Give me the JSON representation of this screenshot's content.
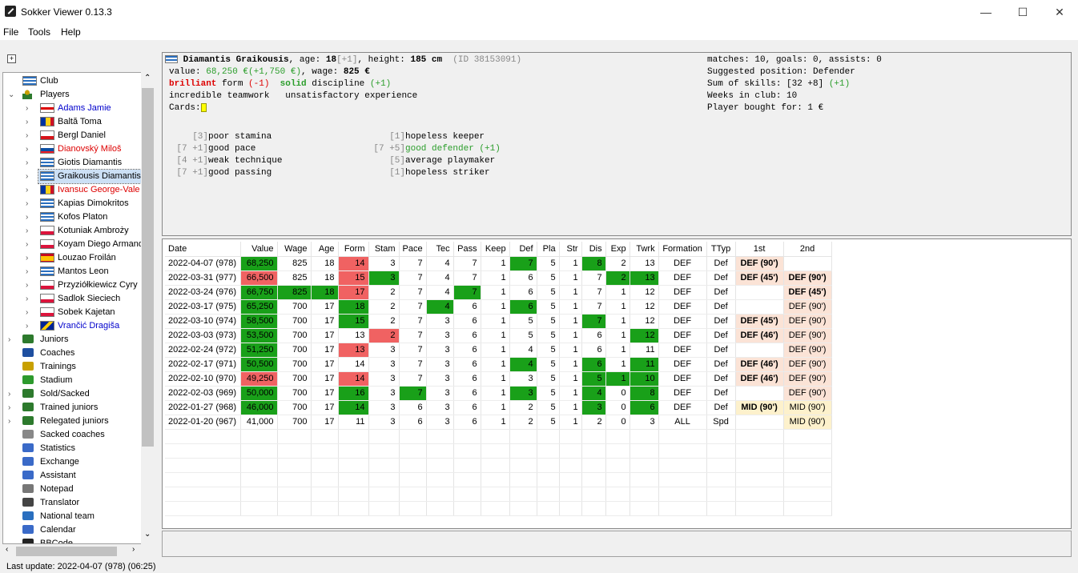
{
  "window": {
    "title": "Sokker Viewer 0.13.3",
    "minimize": "—",
    "maximize": "☐",
    "close": "✕"
  },
  "menu": [
    "File",
    "Tools",
    "Help"
  ],
  "tree": {
    "expand_all": "+",
    "club": "Club",
    "players": "Players",
    "player_list": [
      {
        "name": "Adams Jamie",
        "color": "#0000cc",
        "flag": "england"
      },
      {
        "name": "Baltă Toma",
        "color": "#000",
        "flag": "romania"
      },
      {
        "name": "Bergl Daniel",
        "color": "#000",
        "flag": "czech"
      },
      {
        "name": "Dianovský Miloš",
        "color": "#d00",
        "flag": "slovakia"
      },
      {
        "name": "Giotis Diamantis",
        "color": "#000",
        "flag": "greece"
      },
      {
        "name": "Graikousis Diamantis",
        "color": "#000",
        "flag": "greece",
        "selected": true
      },
      {
        "name": "Ivansuc George-Vale",
        "color": "#d00",
        "flag": "romania"
      },
      {
        "name": "Kapias Dimokritos",
        "color": "#000",
        "flag": "greece"
      },
      {
        "name": "Kofos Platon",
        "color": "#000",
        "flag": "greece"
      },
      {
        "name": "Kotuniak Ambroży",
        "color": "#000",
        "flag": "poland"
      },
      {
        "name": "Koyam Diego Armand",
        "color": "#000",
        "flag": "poland"
      },
      {
        "name": "Louzao Froilán",
        "color": "#000",
        "flag": "spain"
      },
      {
        "name": "Mantos Leon",
        "color": "#000",
        "flag": "greece"
      },
      {
        "name": "Przyziółkiewicz Cyry",
        "color": "#000",
        "flag": "poland"
      },
      {
        "name": "Sadlok Sieciech",
        "color": "#000",
        "flag": "poland"
      },
      {
        "name": "Sobek Kajetan",
        "color": "#000",
        "flag": "poland"
      },
      {
        "name": "Vrančić Dragiša",
        "color": "#0000cc",
        "flag": "bosnia"
      }
    ],
    "sections": [
      {
        "name": "Juniors",
        "icon": "junior-icon",
        "expandable": true
      },
      {
        "name": "Coaches",
        "icon": "coach-icon",
        "expandable": false
      },
      {
        "name": "Trainings",
        "icon": "training-icon",
        "expandable": false
      },
      {
        "name": "Stadium",
        "icon": "stadium-icon",
        "expandable": false
      },
      {
        "name": "Sold/Sacked",
        "icon": "sold-icon",
        "expandable": true
      },
      {
        "name": "Trained juniors",
        "icon": "trained-juniors-icon",
        "expandable": true
      },
      {
        "name": "Relegated juniors",
        "icon": "relegated-juniors-icon",
        "expandable": true
      },
      {
        "name": "Sacked coaches",
        "icon": "sacked-coaches-icon",
        "expandable": false
      },
      {
        "name": "Statistics",
        "icon": "statistics-icon",
        "expandable": false
      },
      {
        "name": "Exchange",
        "icon": "exchange-icon",
        "expandable": false
      },
      {
        "name": "Assistant",
        "icon": "assistant-icon",
        "expandable": false
      },
      {
        "name": "Notepad",
        "icon": "notepad-icon",
        "expandable": false
      },
      {
        "name": "Translator",
        "icon": "translator-icon",
        "expandable": false
      },
      {
        "name": "National team",
        "icon": "national-team-icon",
        "expandable": false
      },
      {
        "name": "Calendar",
        "icon": "calendar-icon",
        "expandable": false
      },
      {
        "name": "BBCode",
        "icon": "bbcode-icon",
        "expandable": false
      }
    ]
  },
  "player": {
    "name": "Diamantis Graikousis",
    "age_label": ", age: ",
    "age": "18",
    "age_change": "[+1]",
    "height_label": ", height: ",
    "height": "185 cm",
    "id": "(ID 38153091)",
    "value_label": "value: ",
    "value": "68,250 €",
    "value_change": "(+1,750 €)",
    "wage_label": ", wage: ",
    "wage": "825 €",
    "form_level": "brilliant",
    "form_word": " form ",
    "form_change": "(-1)",
    "discipline_level": "solid",
    "discipline_word": " discipline ",
    "discipline_change": "(+1)",
    "teamwork": "incredible teamwork",
    "experience": "unsatisfactory experience",
    "cards_label": "Cards:",
    "skills_left": [
      {
        "tag": "[3]",
        "text": "poor stamina",
        "change": ""
      },
      {
        "tag": "[7 +1]",
        "text": "good pace",
        "change": ""
      },
      {
        "tag": "[4 +1]",
        "text": "weak technique",
        "change": ""
      },
      {
        "tag": "[7 +1]",
        "text": "good passing",
        "change": ""
      }
    ],
    "skills_right": [
      {
        "tag": "[1]",
        "text": "hopeless keeper",
        "change": ""
      },
      {
        "tag": "[7 +5]",
        "text": "good defender",
        "change": " (+1)"
      },
      {
        "tag": "[5]",
        "text": "average playmaker",
        "change": ""
      },
      {
        "tag": "[1]",
        "text": "hopeless striker",
        "change": ""
      }
    ],
    "stats": {
      "matches": "matches: 10, goals: 0, assists: 0",
      "suggested": "Suggested position: Defender",
      "skills_sum": "Sum of skills: [32 +8]",
      "skills_sum_change": " (+1)",
      "weeks": "Weeks in club: 10",
      "bought": "Player bought for: 1 €"
    }
  },
  "table": {
    "headers": [
      "Date",
      "Value",
      "Wage",
      "Age",
      "Form",
      "Stam",
      "Pace",
      "Tec",
      "Pass",
      "Keep",
      "Def",
      "Pla",
      "Str",
      "Dis",
      "Exp",
      "Twrk",
      "Formation",
      "TTyp",
      "1st",
      "2nd"
    ],
    "rows": [
      [
        "2022-04-07 (978)",
        "68,250",
        "825",
        "18",
        "14",
        "3",
        "7",
        "4",
        "7",
        "1",
        "7",
        "5",
        "1",
        "8",
        "2",
        "13",
        "DEF",
        "Def",
        "DEF (90')",
        ""
      ],
      [
        "2022-03-31 (977)",
        "66,500",
        "825",
        "18",
        "15",
        "3",
        "7",
        "4",
        "7",
        "1",
        "6",
        "5",
        "1",
        "7",
        "2",
        "13",
        "DEF",
        "Def",
        "DEF (45')",
        "DEF (90')"
      ],
      [
        "2022-03-24 (976)",
        "66,750",
        "825",
        "18",
        "17",
        "2",
        "7",
        "4",
        "7",
        "1",
        "6",
        "5",
        "1",
        "7",
        "1",
        "12",
        "DEF",
        "Def",
        "",
        "DEF (45')"
      ],
      [
        "2022-03-17 (975)",
        "65,250",
        "700",
        "17",
        "18",
        "2",
        "7",
        "4",
        "6",
        "1",
        "6",
        "5",
        "1",
        "7",
        "1",
        "12",
        "DEF",
        "Def",
        "",
        "DEF (90')"
      ],
      [
        "2022-03-10 (974)",
        "58,500",
        "700",
        "17",
        "15",
        "2",
        "7",
        "3",
        "6",
        "1",
        "5",
        "5",
        "1",
        "7",
        "1",
        "12",
        "DEF",
        "Def",
        "DEF (45')",
        "DEF (90')"
      ],
      [
        "2022-03-03 (973)",
        "53,500",
        "700",
        "17",
        "13",
        "2",
        "7",
        "3",
        "6",
        "1",
        "5",
        "5",
        "1",
        "6",
        "1",
        "12",
        "DEF",
        "Def",
        "DEF (46')",
        "DEF (90')"
      ],
      [
        "2022-02-24 (972)",
        "51,250",
        "700",
        "17",
        "13",
        "3",
        "7",
        "3",
        "6",
        "1",
        "4",
        "5",
        "1",
        "6",
        "1",
        "11",
        "DEF",
        "Def",
        "",
        "DEF (90')"
      ],
      [
        "2022-02-17 (971)",
        "50,500",
        "700",
        "17",
        "14",
        "3",
        "7",
        "3",
        "6",
        "1",
        "4",
        "5",
        "1",
        "6",
        "1",
        "11",
        "DEF",
        "Def",
        "DEF (46')",
        "DEF (90')"
      ],
      [
        "2022-02-10 (970)",
        "49,250",
        "700",
        "17",
        "14",
        "3",
        "7",
        "3",
        "6",
        "1",
        "3",
        "5",
        "1",
        "5",
        "1",
        "10",
        "DEF",
        "Def",
        "DEF (46')",
        "DEF (90')"
      ],
      [
        "2022-02-03 (969)",
        "50,000",
        "700",
        "17",
        "16",
        "3",
        "7",
        "3",
        "6",
        "1",
        "3",
        "5",
        "1",
        "4",
        "0",
        "8",
        "DEF",
        "Def",
        "",
        "DEF (90')"
      ],
      [
        "2022-01-27 (968)",
        "46,000",
        "700",
        "17",
        "14",
        "3",
        "6",
        "3",
        "6",
        "1",
        "2",
        "5",
        "1",
        "3",
        "0",
        "6",
        "DEF",
        "Def",
        "MID (90')",
        "MID (90')"
      ],
      [
        "2022-01-20 (967)",
        "41,000",
        "700",
        "17",
        "11",
        "3",
        "6",
        "3",
        "6",
        "1",
        "2",
        "5",
        "1",
        "2",
        "0",
        "3",
        "ALL",
        "Spd",
        "",
        "MID (90')"
      ]
    ],
    "highlights": [
      {
        "g": [
          1,
          10,
          13
        ],
        "r": [
          4
        ],
        "b1": "sal",
        "b2": ""
      },
      {
        "g": [
          5,
          14,
          15
        ],
        "r": [
          1,
          4
        ],
        "b1": "sal",
        "b2": "sal"
      },
      {
        "g": [
          1,
          2,
          3,
          8
        ],
        "r": [
          4
        ],
        "b1": "",
        "b2": "sal"
      },
      {
        "g": [
          1,
          4,
          7,
          10
        ],
        "r": [],
        "b1": "",
        "b2": "sal"
      },
      {
        "g": [
          1,
          4,
          13
        ],
        "r": [],
        "b1": "sal",
        "b2": "sal"
      },
      {
        "g": [
          1,
          15
        ],
        "r": [
          5
        ],
        "b1": "sal",
        "b2": "sal"
      },
      {
        "g": [
          1
        ],
        "r": [
          4
        ],
        "b1": "",
        "b2": "sal"
      },
      {
        "g": [
          1,
          10,
          13,
          15
        ],
        "r": [],
        "b1": "sal",
        "b2": "sal"
      },
      {
        "g": [
          13,
          14,
          15
        ],
        "r": [
          1,
          4
        ],
        "b1": "sal",
        "b2": "sal"
      },
      {
        "g": [
          1,
          4,
          6,
          10,
          13,
          15
        ],
        "r": [],
        "b1": "",
        "b2": "sal"
      },
      {
        "g": [
          1,
          4,
          13,
          15
        ],
        "r": [],
        "b1": "yel",
        "b2": "yel"
      },
      {
        "g": [],
        "r": [],
        "b1": "",
        "b2": "yel"
      }
    ]
  },
  "status": "Last update: 2022-04-07 (978) (06:25)"
}
